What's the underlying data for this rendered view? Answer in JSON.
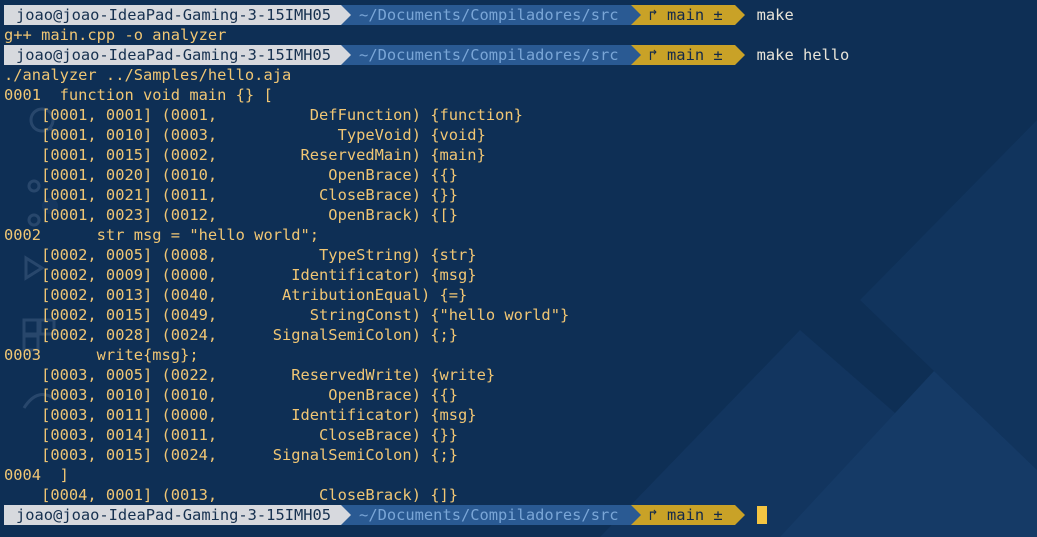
{
  "prompts": [
    {
      "user": "joao@joao-IdeaPad-Gaming-3-15IMH05",
      "path": "~/Documents/Compiladores/src",
      "git": "↱ main ±",
      "command": "make"
    },
    {
      "user": "joao@joao-IdeaPad-Gaming-3-15IMH05",
      "path": "~/Documents/Compiladores/src",
      "git": "↱ main ±",
      "command": "make hello"
    },
    {
      "user": "joao@joao-IdeaPad-Gaming-3-15IMH05",
      "path": "~/Documents/Compiladores/src",
      "git": "↱ main ±",
      "command": ""
    }
  ],
  "output_block_1": [
    "g++ main.cpp -o analyzer"
  ],
  "output_block_2": [
    "./analyzer ../Samples/hello.aja",
    "0001  function void main {} [",
    "    [0001, 0001] (0001,          DefFunction) {function}",
    "    [0001, 0010] (0003,             TypeVoid) {void}",
    "    [0001, 0015] (0002,         ReservedMain) {main}",
    "    [0001, 0020] (0010,            OpenBrace) {{}",
    "    [0001, 0021] (0011,           CloseBrace) {}}",
    "    [0001, 0023] (0012,            OpenBrack) {[}",
    "0002      str msg = \"hello world\";",
    "    [0002, 0005] (0008,           TypeString) {str}",
    "    [0002, 0009] (0000,        Identificator) {msg}",
    "    [0002, 0013] (0040,       AtributionEqual) {=}",
    "    [0002, 0015] (0049,          StringConst) {\"hello world\"}",
    "    [0002, 0028] (0024,      SignalSemiColon) {;}",
    "0003      write{msg};",
    "    [0003, 0005] (0022,        ReservedWrite) {write}",
    "    [0003, 0010] (0010,            OpenBrace) {{}",
    "    [0003, 0011] (0000,        Identificator) {msg}",
    "    [0003, 0014] (0011,           CloseBrace) {}}",
    "    [0003, 0015] (0024,      SignalSemiColon) {;}",
    "0004  ]",
    "    [0004, 0001] (0013,           CloseBrack) {]}"
  ]
}
